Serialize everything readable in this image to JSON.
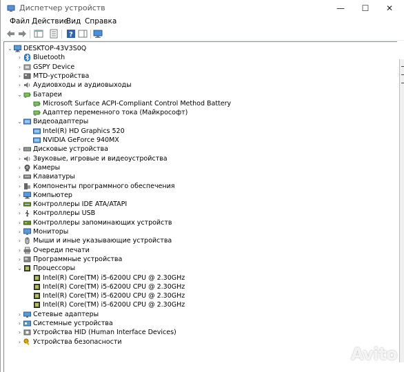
{
  "window": {
    "title": "Диспетчер устройств",
    "minimize": "—",
    "maximize": "☐",
    "close": "✕"
  },
  "menu": [
    "Файл",
    "Действие",
    "Вид",
    "Справка"
  ],
  "tree": {
    "root": "DESKTOP-43V3S0Q",
    "items": [
      {
        "label": "Bluetooth",
        "level": 1,
        "expander": "›",
        "icon": "bluetooth-icon"
      },
      {
        "label": "GSPY Device",
        "level": 1,
        "expander": "›",
        "icon": "device-icon"
      },
      {
        "label": "MTD-устройства",
        "level": 1,
        "expander": "›",
        "icon": "mtd-icon"
      },
      {
        "label": "Аудиовходы и аудиовыходы",
        "level": 1,
        "expander": "›",
        "icon": "audio-icon"
      },
      {
        "label": "Батареи",
        "level": 1,
        "expander": "⌄",
        "icon": "battery-icon"
      },
      {
        "label": "Microsoft Surface ACPI-Compliant Control Method Battery",
        "level": 2,
        "expander": "",
        "icon": "battery-icon"
      },
      {
        "label": "Адаптер переменного тока (Майкрософт)",
        "level": 2,
        "expander": "",
        "icon": "battery-icon"
      },
      {
        "label": "Видеоадаптеры",
        "level": 1,
        "expander": "⌄",
        "icon": "display-adapter-icon"
      },
      {
        "label": "Intel(R) HD Graphics 520",
        "level": 2,
        "expander": "",
        "icon": "display-adapter-icon"
      },
      {
        "label": "NVIDIA GeForce 940MX",
        "level": 2,
        "expander": "",
        "icon": "display-adapter-icon"
      },
      {
        "label": "Дисковые устройства",
        "level": 1,
        "expander": "›",
        "icon": "disk-icon"
      },
      {
        "label": "Звуковые, игровые и видеоустройства",
        "level": 1,
        "expander": "›",
        "icon": "sound-icon"
      },
      {
        "label": "Камеры",
        "level": 1,
        "expander": "›",
        "icon": "camera-icon"
      },
      {
        "label": "Клавиатуры",
        "level": 1,
        "expander": "›",
        "icon": "keyboard-icon"
      },
      {
        "label": "Компоненты программного обеспечения",
        "level": 1,
        "expander": "›",
        "icon": "software-component-icon"
      },
      {
        "label": "Компьютер",
        "level": 1,
        "expander": "›",
        "icon": "computer-icon"
      },
      {
        "label": "Контроллеры IDE ATA/ATAPI",
        "level": 1,
        "expander": "›",
        "icon": "ide-controller-icon"
      },
      {
        "label": "Контроллеры USB",
        "level": 1,
        "expander": "›",
        "icon": "usb-icon"
      },
      {
        "label": "Контроллеры запоминающих устройств",
        "level": 1,
        "expander": "›",
        "icon": "storage-controller-icon"
      },
      {
        "label": "Мониторы",
        "level": 1,
        "expander": "›",
        "icon": "monitor-icon"
      },
      {
        "label": "Мыши и иные указывающие устройства",
        "level": 1,
        "expander": "›",
        "icon": "mouse-icon"
      },
      {
        "label": "Очереди печати",
        "level": 1,
        "expander": "›",
        "icon": "printer-icon"
      },
      {
        "label": "Программные устройства",
        "level": 1,
        "expander": "›",
        "icon": "software-device-icon"
      },
      {
        "label": "Процессоры",
        "level": 1,
        "expander": "⌄",
        "icon": "processor-icon"
      },
      {
        "label": "Intel(R) Core(TM) i5-6200U CPU @ 2.30GHz",
        "level": 2,
        "expander": "",
        "icon": "processor-icon"
      },
      {
        "label": "Intel(R) Core(TM) i5-6200U CPU @ 2.30GHz",
        "level": 2,
        "expander": "",
        "icon": "processor-icon"
      },
      {
        "label": "Intel(R) Core(TM) i5-6200U CPU @ 2.30GHz",
        "level": 2,
        "expander": "",
        "icon": "processor-icon"
      },
      {
        "label": "Intel(R) Core(TM) i5-6200U CPU @ 2.30GHz",
        "level": 2,
        "expander": "",
        "icon": "processor-icon"
      },
      {
        "label": "Сетевые адаптеры",
        "level": 1,
        "expander": "›",
        "icon": "network-adapter-icon"
      },
      {
        "label": "Системные устройства",
        "level": 1,
        "expander": "›",
        "icon": "system-device-icon"
      },
      {
        "label": "Устройства HID (Human Interface Devices)",
        "level": 1,
        "expander": "›",
        "icon": "hid-icon"
      },
      {
        "label": "Устройства безопасности",
        "level": 1,
        "expander": "›",
        "icon": "security-device-icon"
      }
    ]
  },
  "watermark": "Avito"
}
